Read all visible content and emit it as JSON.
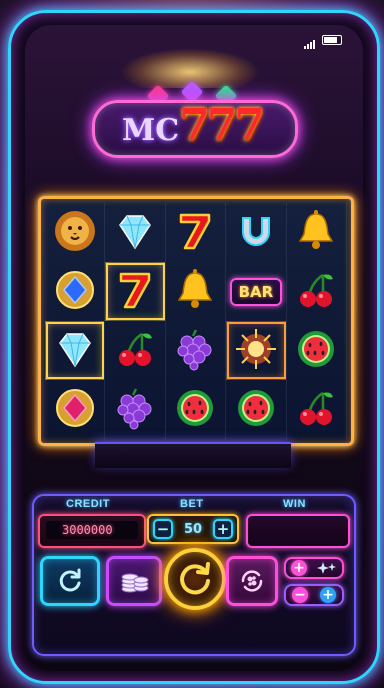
{
  "status_bar": {
    "signal_icon": "signal-bars-icon",
    "battery_icon": "battery-icon"
  },
  "logo": {
    "prefix": "MC",
    "number": "777"
  },
  "reels": [
    [
      "lion",
      "diamond",
      "seven",
      "horseshoe",
      "bell"
    ],
    [
      "sapphire-gem",
      "seven",
      "bell",
      "bar",
      "cherry"
    ],
    [
      "diamond",
      "cherry",
      "grapes",
      "star-burst",
      "watermelon"
    ],
    [
      "ruby-gem",
      "grapes",
      "watermelon",
      "watermelon",
      "cherry"
    ]
  ],
  "bar_symbol_text": "BAR",
  "highlighted_cells": [
    "1-1",
    "2-0",
    "2-3"
  ],
  "info": {
    "credit_label": "CREDIT",
    "credit_value": "3000000",
    "bet_label": "BET",
    "bet_value": "50",
    "bet_minus": "−",
    "bet_plus": "+",
    "win_label": "WIN",
    "win_value": ""
  },
  "controls": {
    "refresh_icon": "refresh-icon",
    "coins_icon": "coin-stack-icon",
    "spin_icon": "spin-arrow-icon",
    "auto_icon": "autoplay-icon",
    "small_buttons": [
      {
        "left": "+",
        "right_icon": "sparkle-icon"
      },
      {
        "left": "−",
        "right": "+"
      }
    ]
  },
  "colors": {
    "neon_cyan": "#2fd4ff",
    "neon_pink": "#ff4fd8",
    "neon_gold": "#ffc23a",
    "neon_purple": "#c84bff"
  }
}
